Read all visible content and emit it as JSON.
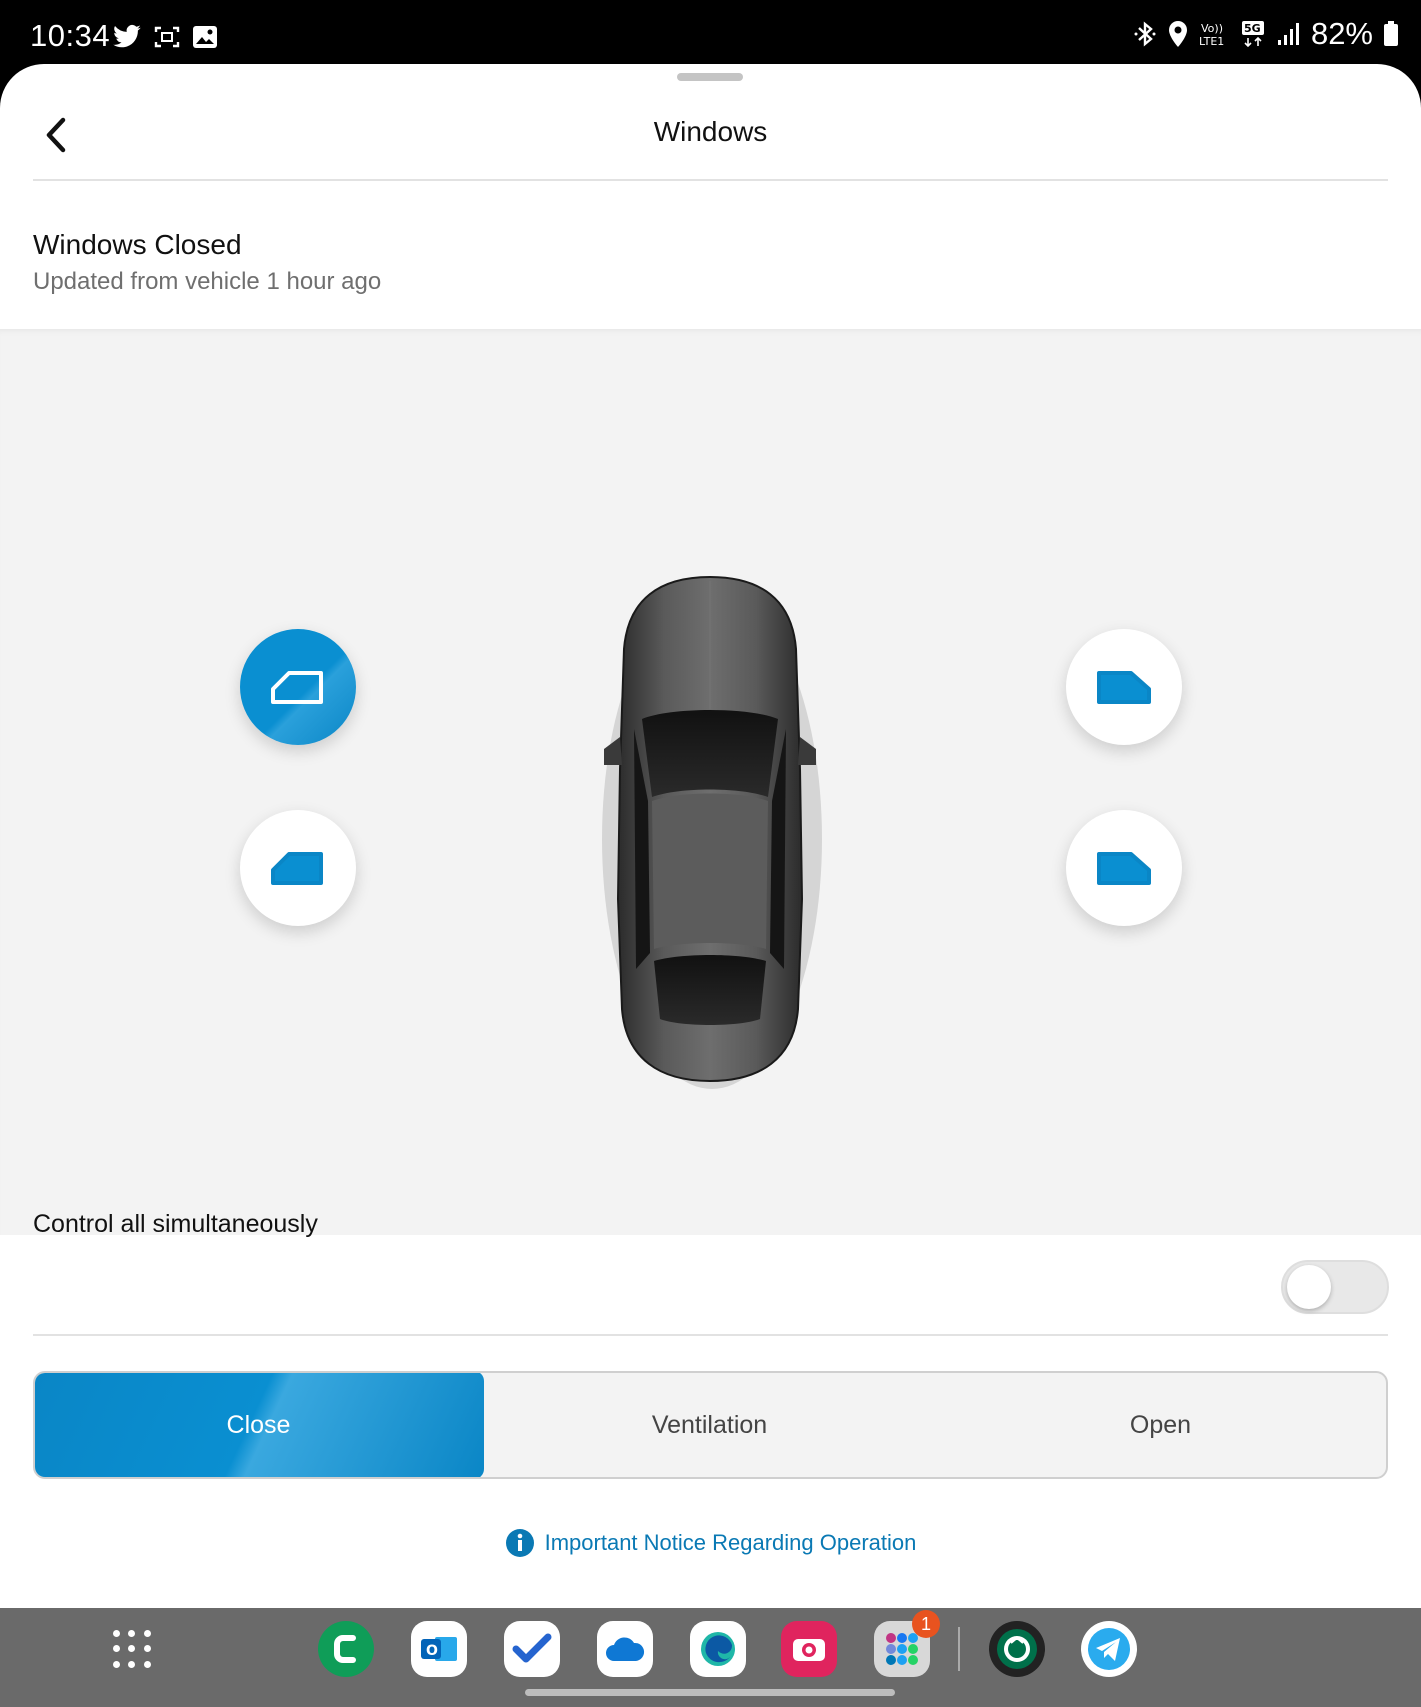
{
  "status_bar": {
    "time": "10:34",
    "battery": "82%",
    "network": "5G"
  },
  "header": {
    "title": "Windows"
  },
  "status": {
    "title": "Windows Closed",
    "subtitle": "Updated from vehicle  1 hour ago"
  },
  "controls": {
    "simultaneous_label": "Control all simultaneously",
    "simultaneous_on": false,
    "modes": [
      {
        "label": "Close",
        "active": true
      },
      {
        "label": "Ventilation",
        "active": false
      },
      {
        "label": "Open",
        "active": false
      }
    ],
    "notice": "Important Notice Regarding Operation"
  },
  "dock": {
    "folder_badge": "1"
  },
  "colors": {
    "accent": "#0a8fd1",
    "panel": "#f3f3f3"
  }
}
